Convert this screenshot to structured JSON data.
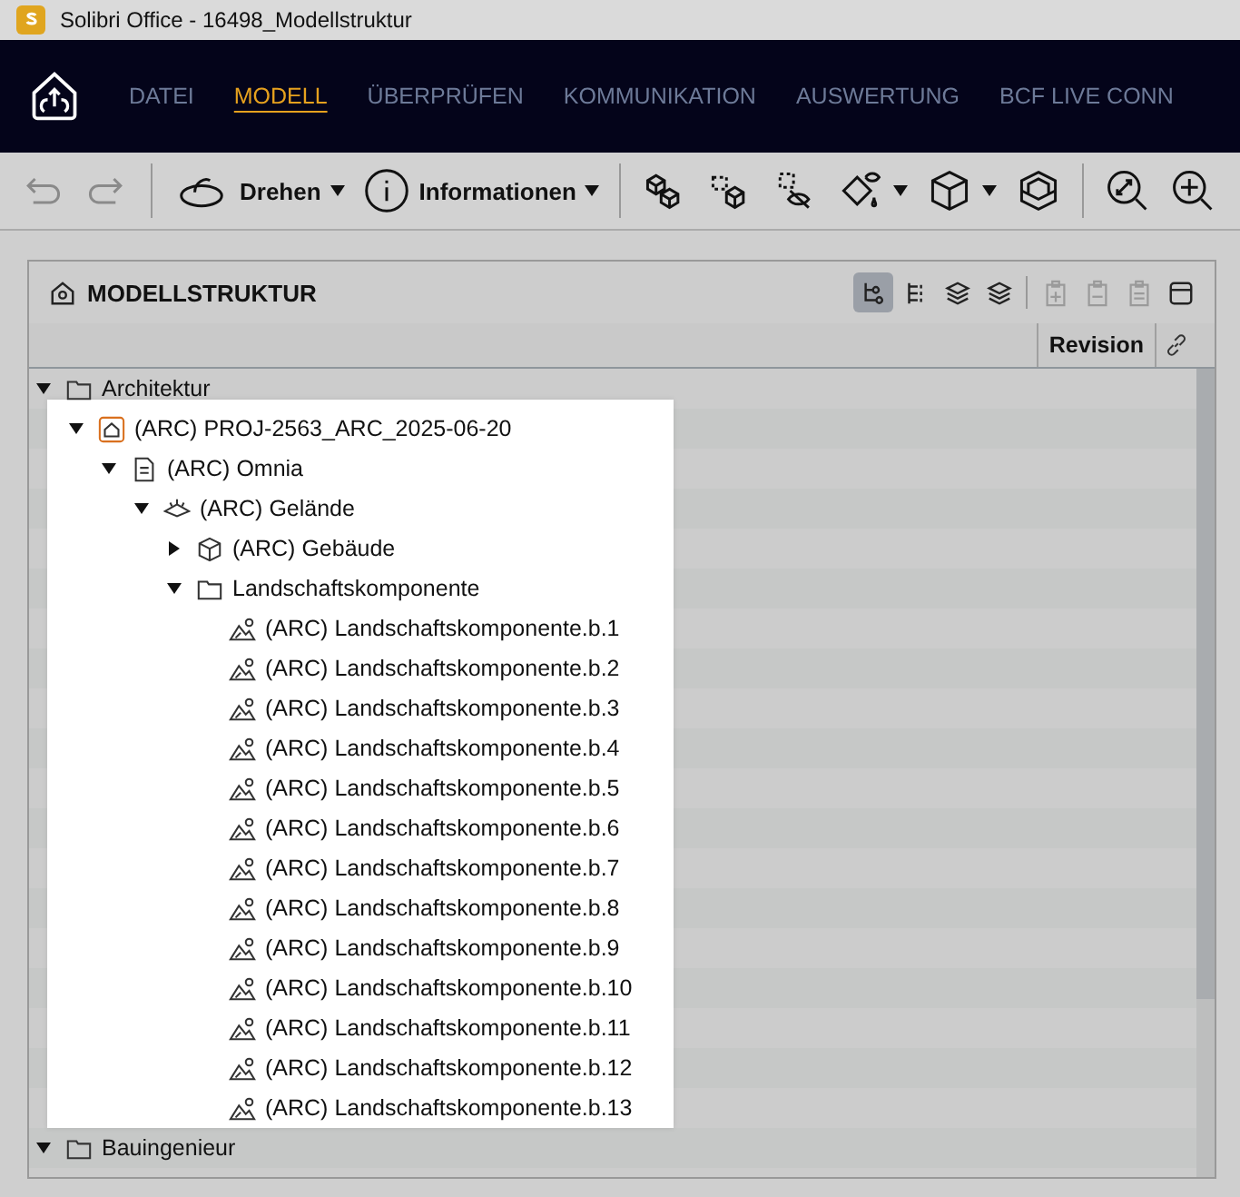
{
  "window": {
    "title": "Solibri Office - 16498_Modellstruktur"
  },
  "menu": [
    {
      "label": "DATEI",
      "selected": false
    },
    {
      "label": "MODELL",
      "selected": true
    },
    {
      "label": "ÜBERPRÜFEN",
      "selected": false
    },
    {
      "label": "KOMMUNIKATION",
      "selected": false
    },
    {
      "label": "AUSWERTUNG",
      "selected": false
    },
    {
      "label": "BCF LIVE CONN",
      "selected": false
    }
  ],
  "toolbar": [
    {
      "kind": "undo",
      "disabled": true
    },
    {
      "kind": "redo",
      "disabled": true
    },
    {
      "kind": "sep"
    },
    {
      "kind": "rotate",
      "label": "Drehen",
      "dropdown": true
    },
    {
      "kind": "info",
      "label": "Informationen",
      "dropdown": true
    },
    {
      "kind": "sep"
    },
    {
      "kind": "cubes"
    },
    {
      "kind": "cubes-select"
    },
    {
      "kind": "hide"
    },
    {
      "kind": "paint",
      "dropdown": true
    },
    {
      "kind": "cube",
      "dropdown": true
    },
    {
      "kind": "box"
    },
    {
      "kind": "sep"
    },
    {
      "kind": "zoom-fit"
    },
    {
      "kind": "zoom-in"
    }
  ],
  "panel": {
    "title": "MODELLSTRUKTUR",
    "view_buttons": [
      {
        "selected": true
      },
      {
        "selected": false
      },
      {
        "selected": false
      },
      {
        "selected": false
      }
    ],
    "action_buttons": [
      {
        "disabled": true
      },
      {
        "disabled": true
      },
      {
        "disabled": true
      }
    ],
    "columns": [
      {
        "label": "Revision"
      }
    ],
    "tree": [
      {
        "label": "Architektur",
        "kind": "folder",
        "expanded": true,
        "children": [
          {
            "label": "(ARC) PROJ-2563_ARC_2025-06-20",
            "kind": "project",
            "expanded": true,
            "children": [
              {
                "label": "(ARC) Omnia",
                "kind": "file",
                "expanded": true,
                "children": [
                  {
                    "label": "(ARC) Gelände",
                    "kind": "site",
                    "expanded": true,
                    "children": [
                      {
                        "label": "(ARC) Gebäude",
                        "kind": "building",
                        "expanded": false
                      },
                      {
                        "label": "Landschaftskomponente",
                        "kind": "folder",
                        "expanded": true,
                        "children": [
                          {
                            "label": "(ARC) Landschaftskomponente.b.1",
                            "kind": "landscape"
                          },
                          {
                            "label": "(ARC) Landschaftskomponente.b.2",
                            "kind": "landscape"
                          },
                          {
                            "label": "(ARC) Landschaftskomponente.b.3",
                            "kind": "landscape"
                          },
                          {
                            "label": "(ARC) Landschaftskomponente.b.4",
                            "kind": "landscape"
                          },
                          {
                            "label": "(ARC) Landschaftskomponente.b.5",
                            "kind": "landscape"
                          },
                          {
                            "label": "(ARC) Landschaftskomponente.b.6",
                            "kind": "landscape"
                          },
                          {
                            "label": "(ARC) Landschaftskomponente.b.7",
                            "kind": "landscape"
                          },
                          {
                            "label": "(ARC) Landschaftskomponente.b.8",
                            "kind": "landscape"
                          },
                          {
                            "label": "(ARC) Landschaftskomponente.b.9",
                            "kind": "landscape"
                          },
                          {
                            "label": "(ARC) Landschaftskomponente.b.10",
                            "kind": "landscape"
                          },
                          {
                            "label": "(ARC) Landschaftskomponente.b.11",
                            "kind": "landscape"
                          },
                          {
                            "label": "(ARC) Landschaftskomponente.b.12",
                            "kind": "landscape"
                          },
                          {
                            "label": "(ARC) Landschaftskomponente.b.13",
                            "kind": "landscape"
                          }
                        ]
                      }
                    ]
                  }
                ]
              }
            ]
          }
        ]
      },
      {
        "label": "Bauingenieur",
        "kind": "folder",
        "expanded": true
      }
    ]
  }
}
